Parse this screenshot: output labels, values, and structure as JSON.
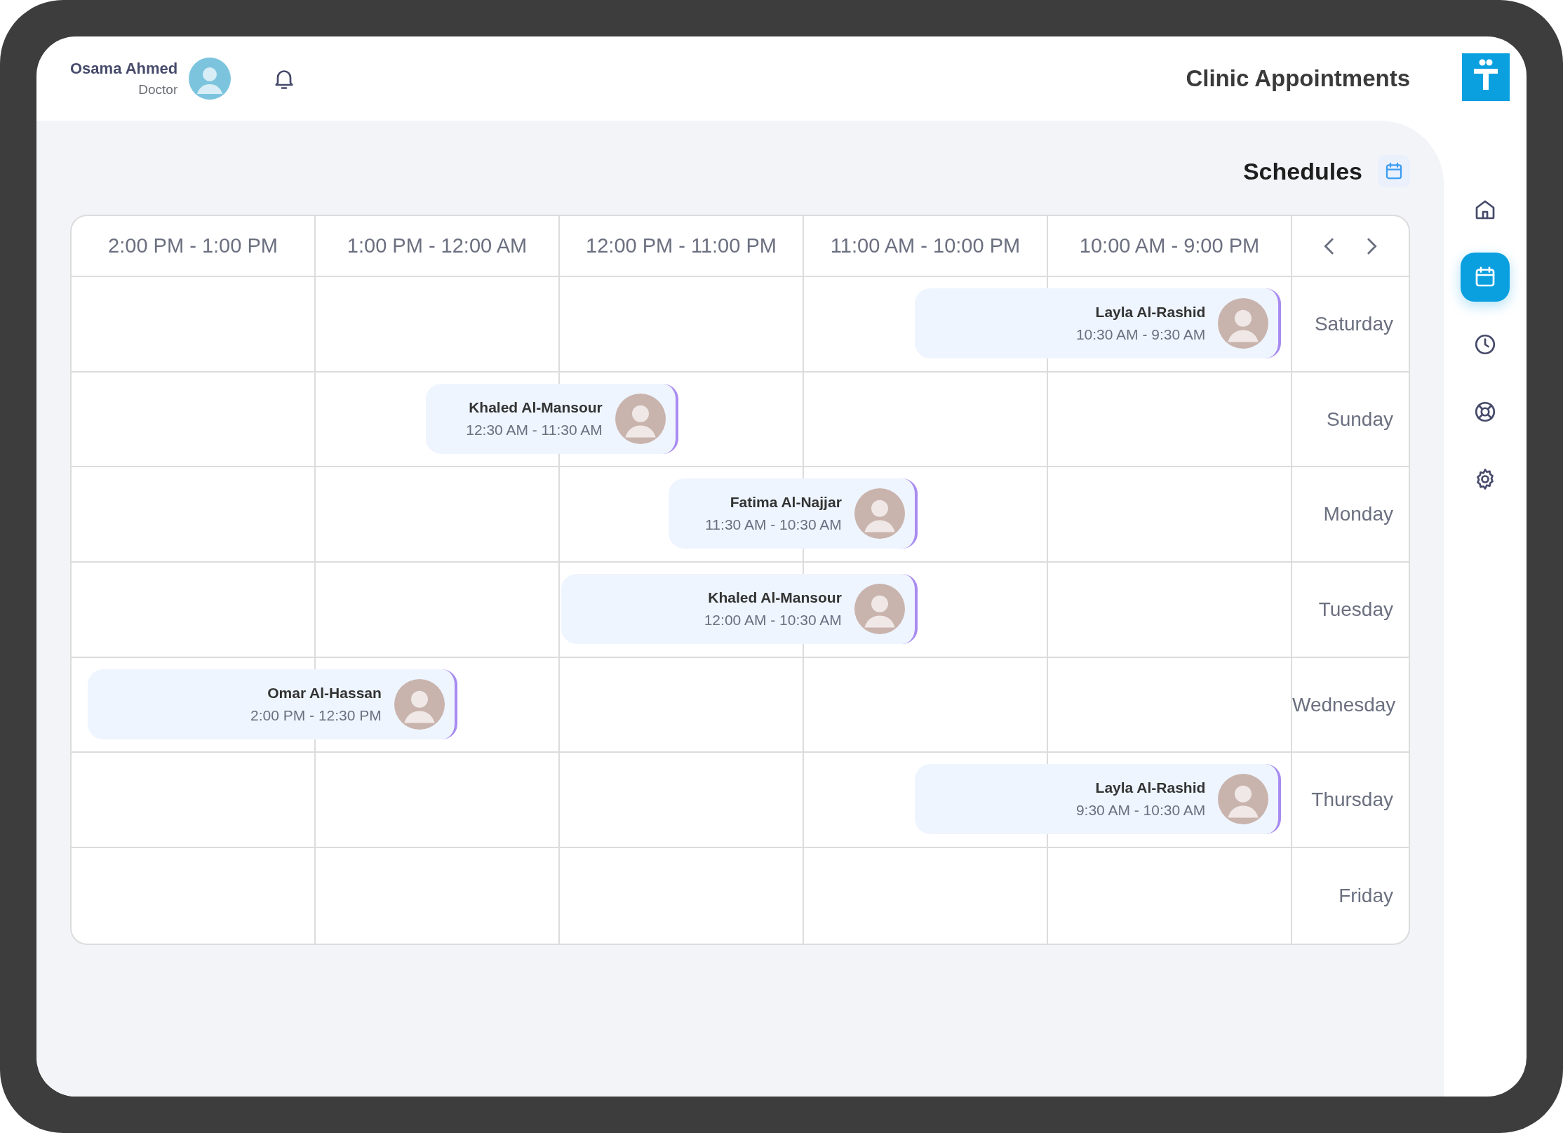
{
  "header": {
    "user": {
      "name": "Osama Ahmed",
      "role": "Doctor"
    },
    "title": "Clinic Appointments"
  },
  "schedules": {
    "title": "Schedules",
    "columns": [
      "2:00 PM - 1:00 PM",
      "1:00 PM - 12:00 AM",
      "12:00 PM - 11:00 PM",
      "11:00 AM - 10:00 PM",
      "10:00 AM - 9:00 PM"
    ],
    "rows": [
      {
        "day": "Saturday",
        "appointments": [
          {
            "patient": "Layla Al-Rashid",
            "time": "10:30 AM - 9:30 AM"
          }
        ]
      },
      {
        "day": "Sunday",
        "appointments": [
          {
            "patient": "Khaled Al-Mansour",
            "time": "12:30 AM - 11:30 AM"
          }
        ]
      },
      {
        "day": "Monday",
        "appointments": [
          {
            "patient": "Fatima Al-Najjar",
            "time": "11:30 AM - 10:30 AM"
          }
        ]
      },
      {
        "day": "Tuesday",
        "appointments": [
          {
            "patient": "Khaled Al-Mansour",
            "time": "12:00 AM - 10:30 AM"
          }
        ]
      },
      {
        "day": "Wednesday",
        "appointments": [
          {
            "patient": "Omar Al-Hassan",
            "time": "2:00 PM - 12:30 PM"
          }
        ]
      },
      {
        "day": "Thursday",
        "appointments": [
          {
            "patient": "Layla Al-Rashid",
            "time": "9:30 AM - 10:30 AM"
          }
        ]
      },
      {
        "day": "Friday",
        "appointments": []
      }
    ]
  },
  "sidebar": {
    "items": [
      {
        "kind": "home",
        "selected": false
      },
      {
        "kind": "calendar",
        "selected": true
      },
      {
        "kind": "clock",
        "selected": false
      },
      {
        "kind": "support",
        "selected": false
      },
      {
        "kind": "settings",
        "selected": false
      }
    ]
  }
}
